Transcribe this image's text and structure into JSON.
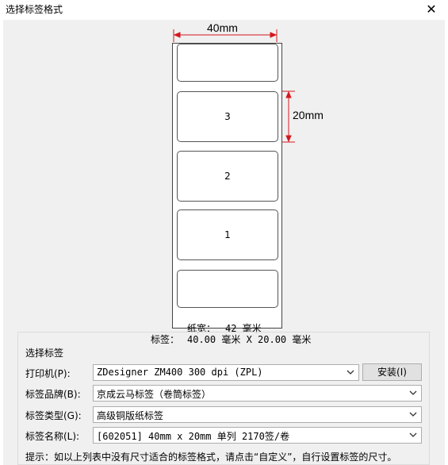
{
  "window": {
    "title": "选择标签格式"
  },
  "preview": {
    "width_dim": "40mm",
    "height_dim": "20mm",
    "labels": [
      {
        "number": ""
      },
      {
        "number": "3"
      },
      {
        "number": "2"
      },
      {
        "number": "1"
      },
      {
        "number": ""
      }
    ],
    "paper_width_label": "纸宽：",
    "paper_width_value": "42 毫米",
    "label_size_label": "标签：",
    "label_size_value": "40.00 毫米 X 20.00 毫米"
  },
  "select_group": {
    "title": "选择标签",
    "printer_label": "打印机(P):",
    "printer_value": "ZDesigner ZM400 300 dpi (ZPL)",
    "install_button": "安装(I)",
    "brand_label": "标签品牌(B):",
    "brand_value": "京成云马标签（卷筒标签）",
    "type_label": "标签类型(G):",
    "type_value": "高级铜版纸标签",
    "name_label": "标签名称(L):",
    "name_value": "[602051] 40mm x 20mm 单列 2170签/卷"
  },
  "hint": "提示：如以上列表中没有尺寸适合的标签格式，请点击“自定义”，自行设置标签的尺寸。",
  "colors": {
    "dimension": "#d4181f",
    "background": "#f0f0f0"
  }
}
